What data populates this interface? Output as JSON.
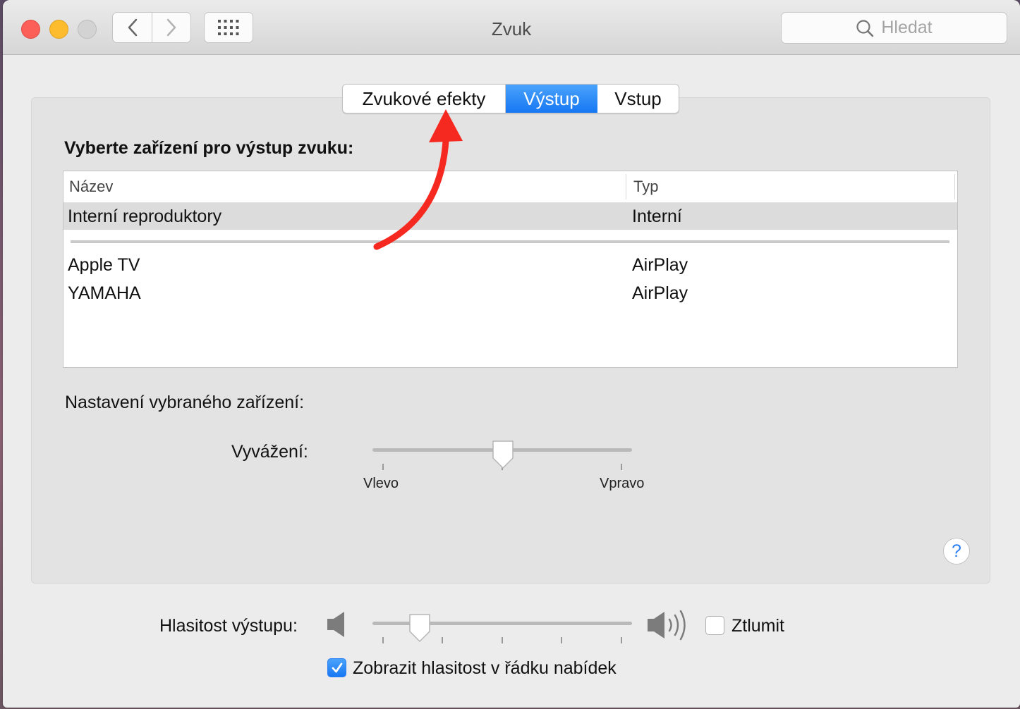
{
  "window": {
    "title": "Zvuk",
    "search_placeholder": "Hledat"
  },
  "tabs": [
    {
      "label": "Zvukové efekty",
      "selected": false
    },
    {
      "label": "Výstup",
      "selected": true
    },
    {
      "label": "Vstup",
      "selected": false
    }
  ],
  "output": {
    "heading": "Vyberte zařízení pro výstup zvuku:",
    "columns": {
      "name": "Název",
      "type": "Typ"
    },
    "devices": [
      {
        "name": "Interní reproduktory",
        "type": "Interní",
        "selected": true
      },
      {
        "name": "Apple TV",
        "type": "AirPlay",
        "selected": false
      },
      {
        "name": "YAMAHA",
        "type": "AirPlay",
        "selected": false
      }
    ]
  },
  "device_settings": {
    "label": "Nastavení vybraného zařízení:",
    "balance_label": "Vyvážení:",
    "balance_left": "Vlevo",
    "balance_right": "Vpravo",
    "balance_value": 0.5
  },
  "volume": {
    "label": "Hlasitost výstupu:",
    "value": 0.15,
    "mute_label": "Ztlumit",
    "mute_checked": false,
    "show_in_menu_label": "Zobrazit hlasitost v řádku nabídek",
    "show_in_menu_checked": true
  },
  "help_label": "?",
  "colors": {
    "accent": "#1677f3",
    "annotation_arrow": "#f5291f"
  }
}
